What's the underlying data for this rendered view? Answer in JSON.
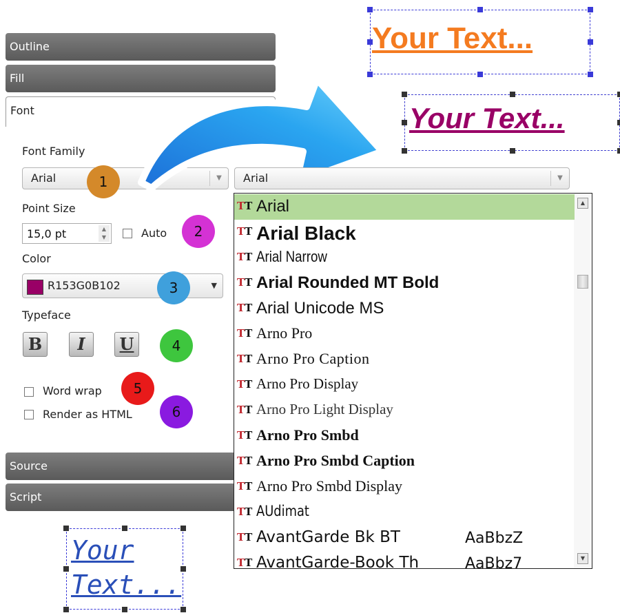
{
  "panels": {
    "outline": "Outline",
    "fill": "Fill",
    "font": "Font",
    "source": "Source",
    "script": "Script"
  },
  "font": {
    "family_label": "Font Family",
    "family_value": "Arial",
    "dropdown_value": "Arial",
    "point_size_label": "Point Size",
    "point_size_value": "15,0 pt",
    "auto_label": "Auto",
    "color_label": "Color",
    "color_value": "R153G0B102",
    "color_swatch": "#990066",
    "typeface_label": "Typeface",
    "bold": "B",
    "italic": "I",
    "underline": "U",
    "word_wrap_label": "Word wrap",
    "render_html_label": "Render as HTML"
  },
  "badges": [
    {
      "label": "1",
      "color": "#d4892a"
    },
    {
      "label": "2",
      "color": "#d432d4"
    },
    {
      "label": "3",
      "color": "#3fa0dc"
    },
    {
      "label": "4",
      "color": "#3ec63e"
    },
    {
      "label": "5",
      "color": "#e81a1a"
    },
    {
      "label": "6",
      "color": "#8a1ae0"
    }
  ],
  "font_list": [
    {
      "name": "Arial",
      "selected": true
    },
    {
      "name": "Arial Black"
    },
    {
      "name": "Arial Narrow"
    },
    {
      "name": "Arial Rounded MT Bold"
    },
    {
      "name": "Arial Unicode MS"
    },
    {
      "name": "Arno Pro"
    },
    {
      "name": "Arno Pro Caption"
    },
    {
      "name": "Arno Pro Display"
    },
    {
      "name": "Arno Pro Light Display"
    },
    {
      "name": "Arno Pro Smbd"
    },
    {
      "name": "Arno Pro Smbd Caption"
    },
    {
      "name": "Arno Pro Smbd Display"
    },
    {
      "name": "AUdimat"
    },
    {
      "name": "AvantGarde Bk BT",
      "sample": "AaBbzZ"
    },
    {
      "name": "AvantGarde-Book Th",
      "sample": "AaBbz7"
    }
  ],
  "previews": {
    "orange": {
      "text": "Your Text...",
      "color": "#f47b20"
    },
    "purple": {
      "text": "Your Text...",
      "color": "#990066"
    },
    "blue_line1": "Your",
    "blue_line2": "Text...",
    "blue_color": "#2a4fb8"
  }
}
